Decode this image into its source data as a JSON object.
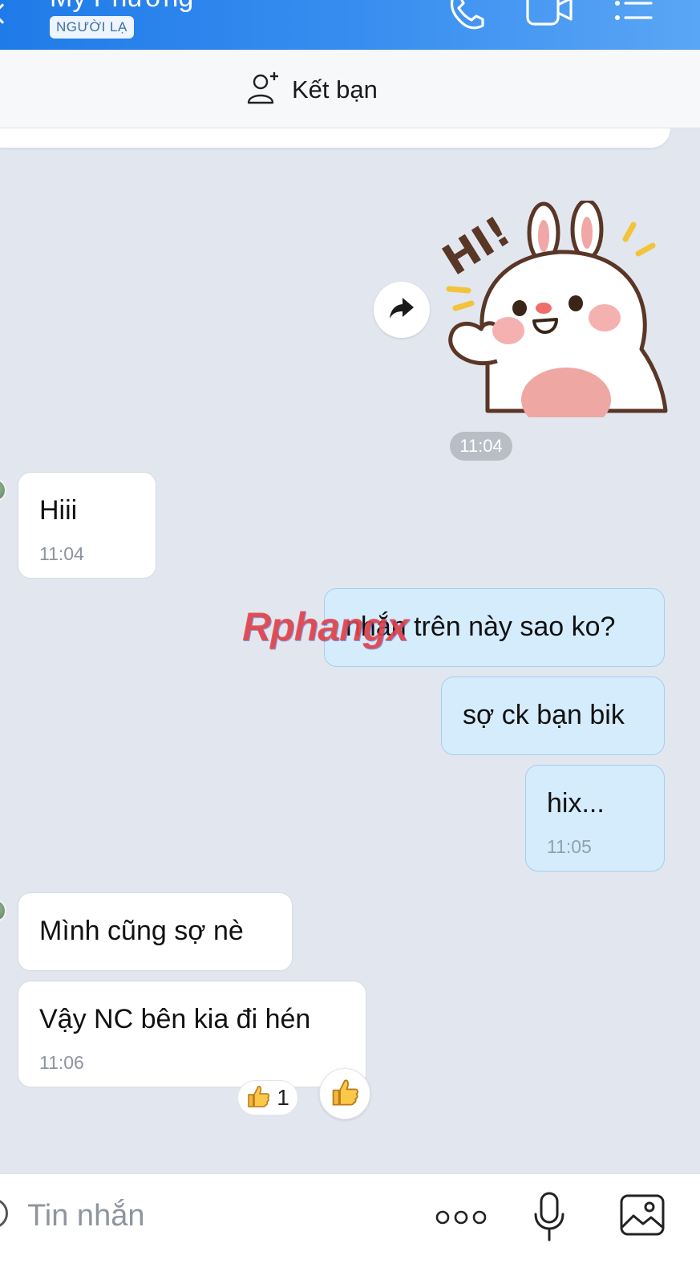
{
  "header": {
    "contact_name": "My Phương",
    "badge": "NGƯỜI LẠ",
    "icons": [
      "back-icon",
      "phone-icon",
      "video-call-icon",
      "menu-icon"
    ]
  },
  "add_friend": {
    "label": "Kết bạn",
    "icon": "add-user-icon"
  },
  "sticker": {
    "text": "HI!",
    "time": "11:04"
  },
  "messages": [
    {
      "from": "them",
      "text": "Hiii",
      "time": "11:04"
    },
    {
      "from": "me",
      "text": "nhắn trên này sao ko?"
    },
    {
      "from": "me",
      "text": "sợ ck bạn bik"
    },
    {
      "from": "me",
      "text": "hix...",
      "time": "11:05"
    },
    {
      "from": "them",
      "text": "Mình cũng sợ nè"
    },
    {
      "from": "them",
      "text": "Vậy NC bên kia đi hén",
      "time": "11:06"
    }
  ],
  "reaction": {
    "emoji": "👍",
    "count": "1"
  },
  "watermark": "Rphangx",
  "composer": {
    "placeholder": "Tin nhắn",
    "icons": [
      "more-icon",
      "microphone-icon",
      "image-icon"
    ]
  },
  "colors": {
    "header_start": "#1f7be8",
    "header_end": "#5aa6f5",
    "chat_background": "#e2e6ef",
    "outgoing_bubble": "#d5ecfd",
    "incoming_bubble": "#ffffff"
  }
}
